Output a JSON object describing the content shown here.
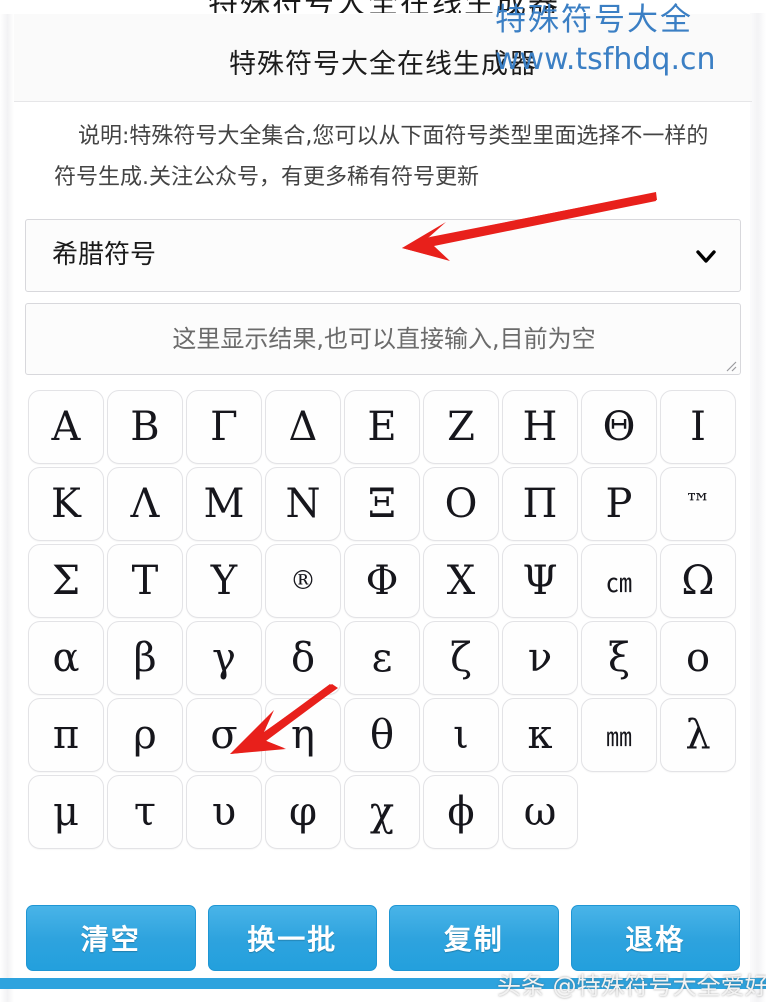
{
  "page": {
    "cut_off_top_text": "特殊符号大全在线生成器",
    "title": "特殊符号大全在线生成器",
    "description": "说明:特殊符号大全集合,您可以从下面符号类型里面选择不一样的符号生成.关注公众号，有更多稀有符号更新"
  },
  "watermarks": {
    "top_line1": "特殊符号大全",
    "top_line2": "www.tsfhdq.cn",
    "top_color": "#3b7fc4",
    "bottom": "头条 @特殊符号大全爱好者"
  },
  "category_select": {
    "value": "希腊符号",
    "chevron_icon": "chevron-down-icon"
  },
  "result_textarea": {
    "value": "",
    "placeholder": "这里显示结果,也可以直接输入,目前为空",
    "resize_handle_icon": "resize-grip-icon"
  },
  "symbol_grid": {
    "rows": [
      [
        "Α",
        "Β",
        "Γ",
        "Δ",
        "Ε",
        "Ζ",
        "Η",
        "Θ",
        "Ι"
      ],
      [
        "Κ",
        "Λ",
        "Μ",
        "Ν",
        "Ξ",
        "Ο",
        "Π",
        "Ρ",
        "™"
      ],
      [
        "Σ",
        "Τ",
        "Υ",
        "®",
        "Φ",
        "Χ",
        "Ψ",
        "㎝",
        "Ω"
      ],
      [
        "α",
        "β",
        "γ",
        "δ",
        "ε",
        "ζ",
        "ν",
        "ξ",
        "ο"
      ],
      [
        "π",
        "ρ",
        "σ",
        "η",
        "θ",
        "ι",
        "κ",
        "㎜",
        "λ"
      ],
      [
        "μ",
        "τ",
        "υ",
        "φ",
        "χ",
        "ϕ",
        "ω"
      ]
    ]
  },
  "buttons": {
    "accent_color": "#2ea3de",
    "items": [
      {
        "label": "清空",
        "name": "clear-button"
      },
      {
        "label": "换一批",
        "name": "shuffle-button"
      },
      {
        "label": "复制",
        "name": "copy-button"
      },
      {
        "label": "退格",
        "name": "backspace-button"
      }
    ]
  },
  "annotations": {
    "arrow_color": "#e8201b",
    "arrow_1_target": "category-select",
    "arrow_2_target": "symbol-key-sigma"
  }
}
